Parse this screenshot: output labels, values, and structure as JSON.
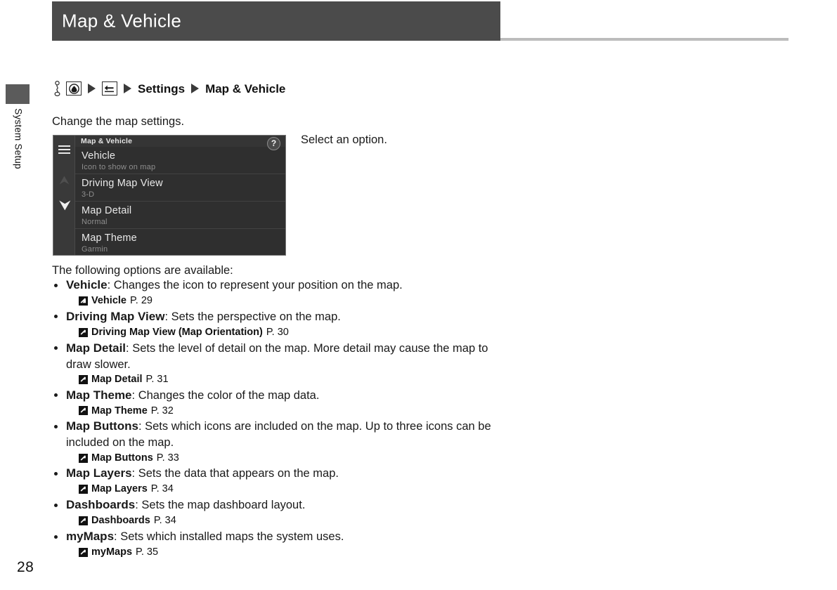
{
  "chapter": {
    "tab_label": "System Setup"
  },
  "page": {
    "number": "28"
  },
  "header": {
    "title": "Map & Vehicle"
  },
  "breadcrumb": {
    "icon_stylus": "stylus-icon",
    "icon_home": "home-circle-icon",
    "icon_back": "back-arrow-icon",
    "settings_label": "Settings",
    "current_label": "Map & Vehicle"
  },
  "body": {
    "intro": "Change the map settings.",
    "select_option": "Select an option.",
    "following": "The following options are available:"
  },
  "device": {
    "title": "Map & Vehicle",
    "help_label": "?",
    "hamburger_icon": "hamburger-menu-icon",
    "scroll_up_icon": "scroll-up-arrow-icon",
    "scroll_down_icon": "scroll-down-arrow-icon",
    "rows": [
      {
        "title": "Vehicle",
        "sub": "Icon to show on map"
      },
      {
        "title": "Driving Map View",
        "sub": "3-D"
      },
      {
        "title": "Map Detail",
        "sub": "Normal"
      },
      {
        "title": "Map Theme",
        "sub": "Garmin"
      }
    ]
  },
  "options": [
    {
      "name": "Vehicle",
      "desc": ": Changes the icon to represent your position on the map.",
      "ref_title": "Vehicle",
      "ref_page": "P. 29"
    },
    {
      "name": "Driving Map View",
      "desc": ": Sets the perspective on the map.",
      "ref_title": "Driving Map View (Map Orientation)",
      "ref_page": "P. 30"
    },
    {
      "name": "Map Detail",
      "desc": ": Sets the level of detail on the map. More detail may cause the map to draw slower.",
      "ref_title": "Map Detail",
      "ref_page": "P. 31"
    },
    {
      "name": "Map Theme",
      "desc": ": Changes the color of the map data.",
      "ref_title": "Map Theme",
      "ref_page": "P. 32"
    },
    {
      "name": "Map Buttons",
      "desc": ": Sets which icons are included on the map. Up to three icons can be included on the map.",
      "ref_title": "Map Buttons",
      "ref_page": "P. 33"
    },
    {
      "name": "Map Layers",
      "desc": ": Sets the data that appears on the map.",
      "ref_title": "Map Layers",
      "ref_page": "P. 34"
    },
    {
      "name": "Dashboards",
      "desc": ": Sets the map dashboard layout.",
      "ref_title": "Dashboards",
      "ref_page": "P. 34"
    },
    {
      "name": "myMaps",
      "desc": ": Sets which installed maps the system uses.",
      "ref_title": "myMaps",
      "ref_page": "P. 35"
    }
  ],
  "colors": {
    "header_bg": "#4b4b4b",
    "rule": "#bcbcbc",
    "device_bg": "#2f2f2f",
    "device_sidebar": "#393939",
    "text": "#1a1a1a"
  }
}
